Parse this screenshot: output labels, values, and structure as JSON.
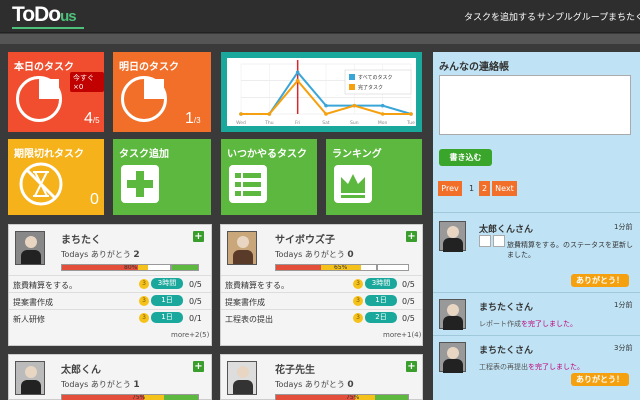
{
  "header": {
    "logo_main": "ToDo",
    "logo_suffix": "us",
    "nav": [
      "タスクを追加する",
      "サンプルグループ",
      "まちたく"
    ]
  },
  "tiles": {
    "today": {
      "title": "本日のタスク",
      "badge": "今すぐ×0",
      "count": "4",
      "total": "/5",
      "progress": 0.2
    },
    "tomorrow": {
      "title": "明日のタスク",
      "count": "1",
      "total": "/3",
      "progress": 0.33
    },
    "overdue": {
      "title": "期限切れタスク",
      "count": "0"
    },
    "add_task": {
      "title": "タスク追加"
    },
    "someday": {
      "title": "いつかやるタスク"
    },
    "ranking": {
      "title": "ランキング"
    }
  },
  "chart_data": {
    "type": "line",
    "categories": [
      "Wed",
      "Thu",
      "Fri",
      "Sat",
      "Sun",
      "Mon",
      "Tue"
    ],
    "series": [
      {
        "name": "すべてのタスク",
        "values": [
          0,
          0,
          5,
          1,
          1,
          1,
          0
        ],
        "color": "#3aa6d8"
      },
      {
        "name": "完了タスク",
        "values": [
          0,
          0,
          4,
          0,
          1,
          0,
          0
        ],
        "color": "#f5a00e"
      }
    ],
    "ylim": [
      0,
      6
    ],
    "highlight_category": "Fri",
    "grid": true,
    "legend": "right"
  },
  "members": [
    {
      "name": "まちたく",
      "todays_label": "Todays ありがとう",
      "thanks": "2",
      "progress_label": "80%",
      "progress": 0.8,
      "tasks": [
        {
          "name": "旅費精算をする。",
          "coin": "3",
          "pill": "3時間",
          "count": "0/5"
        },
        {
          "name": "提案書作成",
          "coin": "3",
          "pill": "1日",
          "count": "0/5"
        },
        {
          "name": "新人研修",
          "coin": "3",
          "pill": "1日",
          "count": "0/1"
        }
      ],
      "more": "more+2(5)"
    },
    {
      "name": "サイボウズ子",
      "todays_label": "Todays ありがとう",
      "thanks": "0",
      "progress_label": "65%",
      "progress": 0.65,
      "tasks": [
        {
          "name": "旅費精算をする。",
          "coin": "3",
          "pill": "3時間",
          "count": "0/5"
        },
        {
          "name": "提案書作成",
          "coin": "3",
          "pill": "1日",
          "count": "0/5"
        },
        {
          "name": "工程表の提出",
          "coin": "3",
          "pill": "2日",
          "count": "0/5"
        }
      ],
      "more": "more+1(4)"
    },
    {
      "name": "太郎くん",
      "todays_label": "Todays ありがとう",
      "thanks": "1",
      "progress_label": "75%",
      "progress": 0.75
    },
    {
      "name": "花子先生",
      "todays_label": "Todays ありがとう",
      "thanks": "0",
      "progress_label": "75%",
      "progress": 0.75
    }
  ],
  "board": {
    "title": "みんなの連絡帳",
    "textarea_value": "",
    "submit": "書き込む",
    "prev": "Prev",
    "pages": [
      "1",
      "2"
    ],
    "next": "Next",
    "posts": [
      {
        "name": "太郎くんさん",
        "time": "1分前",
        "text": "旅費精算をする。のステータスを更新しました。",
        "button": "ありがとう！"
      },
      {
        "name": "まちたくさん",
        "time": "1分前",
        "text_pre": "レポート作成",
        "text_highlight": "を完了しました。"
      },
      {
        "name": "まちたくさん",
        "time": "3分前",
        "text_pre": "工程表の再提出",
        "text_highlight": "を完了しました。",
        "button": "ありがとう！"
      }
    ]
  }
}
